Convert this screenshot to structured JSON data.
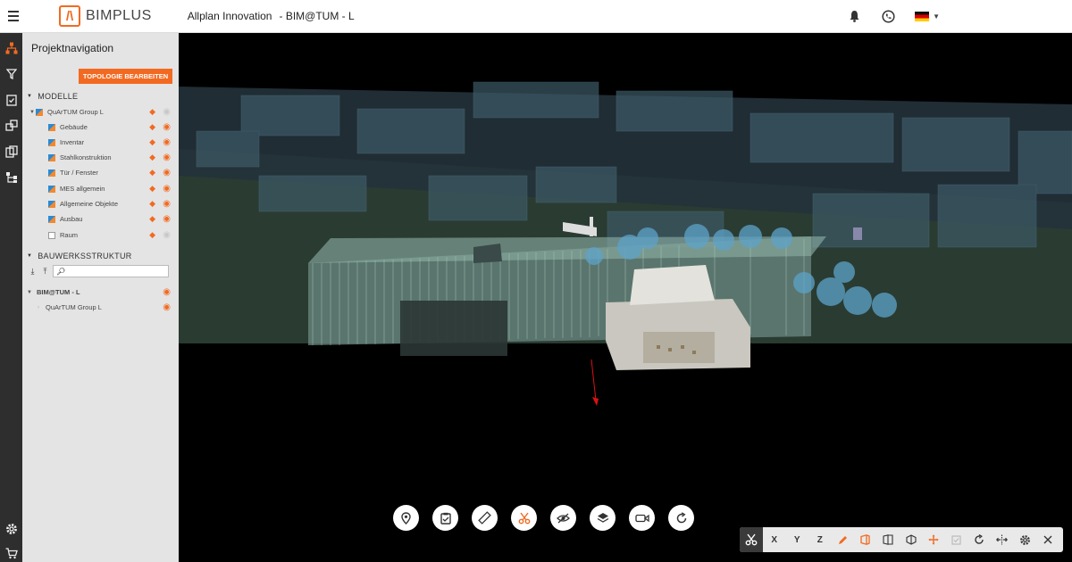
{
  "header": {
    "brand": "BIMPLUS",
    "project": "Allplan Innovation",
    "model": "- BIM@TUM - L"
  },
  "panel": {
    "title": "Projektnavigation",
    "topology_button": "TOPOLOGIE BEARBEITEN",
    "models_section": "MODELLE",
    "models_root": "QuArTUM Group L",
    "models": [
      {
        "label": "Gebäude",
        "checked": true,
        "visible": true
      },
      {
        "label": "Inventar",
        "checked": true,
        "visible": true
      },
      {
        "label": "Stahlkonstruktion",
        "checked": true,
        "visible": true
      },
      {
        "label": "Tür / Fenster",
        "checked": true,
        "visible": true
      },
      {
        "label": "MES allgemein",
        "checked": true,
        "visible": true
      },
      {
        "label": "Allgemeine Objekte",
        "checked": true,
        "visible": true
      },
      {
        "label": "Ausbau",
        "checked": true,
        "visible": true
      },
      {
        "label": "Raum",
        "checked": false,
        "visible": false
      }
    ],
    "structure_section": "BAUWERKSSTRUKTUR",
    "search_placeholder": "",
    "structure_root": "BIM@TUM - L",
    "structure_child": "QuArTUM Group L"
  },
  "bottom_tools": [
    "location-pin-icon",
    "clipboard-icon",
    "ruler-icon",
    "scissors-icon",
    "hide-icon",
    "layers-icon",
    "camera-icon",
    "reset-icon"
  ],
  "section_toolbar": {
    "axes": [
      "X",
      "Y",
      "Z"
    ]
  },
  "colors": {
    "accent": "#f26a21",
    "rail": "#2e2e2e",
    "panel": "#e4e4e4"
  }
}
